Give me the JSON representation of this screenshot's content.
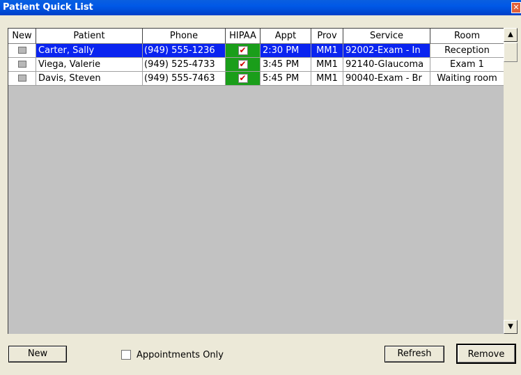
{
  "window": {
    "title": "Patient Quick List",
    "close_glyph": "✕"
  },
  "table": {
    "columns": [
      "New",
      "Patient",
      "Phone",
      "HIPAA",
      "Appt",
      "Prov",
      "Service",
      "Room"
    ],
    "rows": [
      {
        "patient": "Carter, Sally",
        "phone": "(949) 555-1236",
        "hipaa": "✔",
        "appt": "2:30 PM",
        "prov": "MM1",
        "service": "92002-Exam - In",
        "room": "Reception",
        "selected": true
      },
      {
        "patient": "Viega, Valerie",
        "phone": "(949) 525-4733",
        "hipaa": "✔",
        "appt": "3:45 PM",
        "prov": "MM1",
        "service": "92140-Glaucoma",
        "room": "Exam 1",
        "selected": false
      },
      {
        "patient": "Davis, Steven",
        "phone": "(949) 555-7463",
        "hipaa": "✔",
        "appt": "5:45 PM",
        "prov": "MM1",
        "service": "90040-Exam - Br",
        "room": "Waiting room",
        "selected": false
      }
    ]
  },
  "scrollbar": {
    "up_glyph": "▲",
    "down_glyph": "▼"
  },
  "footer": {
    "new_label": "New",
    "appointments_only_label": "Appointments Only",
    "refresh_label": "Refresh",
    "remove_label": "Remove"
  },
  "colors": {
    "selection": "#0A24F0",
    "hipaa_cell": "#1A9E1A",
    "titlebar": "#0058E6"
  }
}
